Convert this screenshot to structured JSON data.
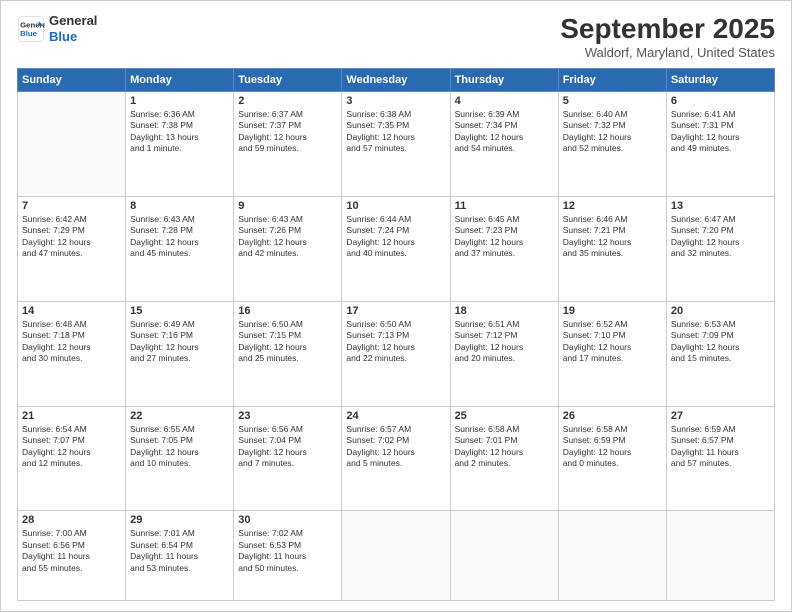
{
  "logo": {
    "line1": "General",
    "line2": "Blue"
  },
  "title": "September 2025",
  "subtitle": "Waldorf, Maryland, United States",
  "days_header": [
    "Sunday",
    "Monday",
    "Tuesday",
    "Wednesday",
    "Thursday",
    "Friday",
    "Saturday"
  ],
  "weeks": [
    [
      {
        "day": "",
        "info": ""
      },
      {
        "day": "1",
        "info": "Sunrise: 6:36 AM\nSunset: 7:38 PM\nDaylight: 13 hours\nand 1 minute."
      },
      {
        "day": "2",
        "info": "Sunrise: 6:37 AM\nSunset: 7:37 PM\nDaylight: 12 hours\nand 59 minutes."
      },
      {
        "day": "3",
        "info": "Sunrise: 6:38 AM\nSunset: 7:35 PM\nDaylight: 12 hours\nand 57 minutes."
      },
      {
        "day": "4",
        "info": "Sunrise: 6:39 AM\nSunset: 7:34 PM\nDaylight: 12 hours\nand 54 minutes."
      },
      {
        "day": "5",
        "info": "Sunrise: 6:40 AM\nSunset: 7:32 PM\nDaylight: 12 hours\nand 52 minutes."
      },
      {
        "day": "6",
        "info": "Sunrise: 6:41 AM\nSunset: 7:31 PM\nDaylight: 12 hours\nand 49 minutes."
      }
    ],
    [
      {
        "day": "7",
        "info": "Sunrise: 6:42 AM\nSunset: 7:29 PM\nDaylight: 12 hours\nand 47 minutes."
      },
      {
        "day": "8",
        "info": "Sunrise: 6:43 AM\nSunset: 7:28 PM\nDaylight: 12 hours\nand 45 minutes."
      },
      {
        "day": "9",
        "info": "Sunrise: 6:43 AM\nSunset: 7:26 PM\nDaylight: 12 hours\nand 42 minutes."
      },
      {
        "day": "10",
        "info": "Sunrise: 6:44 AM\nSunset: 7:24 PM\nDaylight: 12 hours\nand 40 minutes."
      },
      {
        "day": "11",
        "info": "Sunrise: 6:45 AM\nSunset: 7:23 PM\nDaylight: 12 hours\nand 37 minutes."
      },
      {
        "day": "12",
        "info": "Sunrise: 6:46 AM\nSunset: 7:21 PM\nDaylight: 12 hours\nand 35 minutes."
      },
      {
        "day": "13",
        "info": "Sunrise: 6:47 AM\nSunset: 7:20 PM\nDaylight: 12 hours\nand 32 minutes."
      }
    ],
    [
      {
        "day": "14",
        "info": "Sunrise: 6:48 AM\nSunset: 7:18 PM\nDaylight: 12 hours\nand 30 minutes."
      },
      {
        "day": "15",
        "info": "Sunrise: 6:49 AM\nSunset: 7:16 PM\nDaylight: 12 hours\nand 27 minutes."
      },
      {
        "day": "16",
        "info": "Sunrise: 6:50 AM\nSunset: 7:15 PM\nDaylight: 12 hours\nand 25 minutes."
      },
      {
        "day": "17",
        "info": "Sunrise: 6:50 AM\nSunset: 7:13 PM\nDaylight: 12 hours\nand 22 minutes."
      },
      {
        "day": "18",
        "info": "Sunrise: 6:51 AM\nSunset: 7:12 PM\nDaylight: 12 hours\nand 20 minutes."
      },
      {
        "day": "19",
        "info": "Sunrise: 6:52 AM\nSunset: 7:10 PM\nDaylight: 12 hours\nand 17 minutes."
      },
      {
        "day": "20",
        "info": "Sunrise: 6:53 AM\nSunset: 7:09 PM\nDaylight: 12 hours\nand 15 minutes."
      }
    ],
    [
      {
        "day": "21",
        "info": "Sunrise: 6:54 AM\nSunset: 7:07 PM\nDaylight: 12 hours\nand 12 minutes."
      },
      {
        "day": "22",
        "info": "Sunrise: 6:55 AM\nSunset: 7:05 PM\nDaylight: 12 hours\nand 10 minutes."
      },
      {
        "day": "23",
        "info": "Sunrise: 6:56 AM\nSunset: 7:04 PM\nDaylight: 12 hours\nand 7 minutes."
      },
      {
        "day": "24",
        "info": "Sunrise: 6:57 AM\nSunset: 7:02 PM\nDaylight: 12 hours\nand 5 minutes."
      },
      {
        "day": "25",
        "info": "Sunrise: 6:58 AM\nSunset: 7:01 PM\nDaylight: 12 hours\nand 2 minutes."
      },
      {
        "day": "26",
        "info": "Sunrise: 6:58 AM\nSunset: 6:59 PM\nDaylight: 12 hours\nand 0 minutes."
      },
      {
        "day": "27",
        "info": "Sunrise: 6:59 AM\nSunset: 6:57 PM\nDaylight: 11 hours\nand 57 minutes."
      }
    ],
    [
      {
        "day": "28",
        "info": "Sunrise: 7:00 AM\nSunset: 6:56 PM\nDaylight: 11 hours\nand 55 minutes."
      },
      {
        "day": "29",
        "info": "Sunrise: 7:01 AM\nSunset: 6:54 PM\nDaylight: 11 hours\nand 53 minutes."
      },
      {
        "day": "30",
        "info": "Sunrise: 7:02 AM\nSunset: 6:53 PM\nDaylight: 11 hours\nand 50 minutes."
      },
      {
        "day": "",
        "info": ""
      },
      {
        "day": "",
        "info": ""
      },
      {
        "day": "",
        "info": ""
      },
      {
        "day": "",
        "info": ""
      }
    ]
  ]
}
